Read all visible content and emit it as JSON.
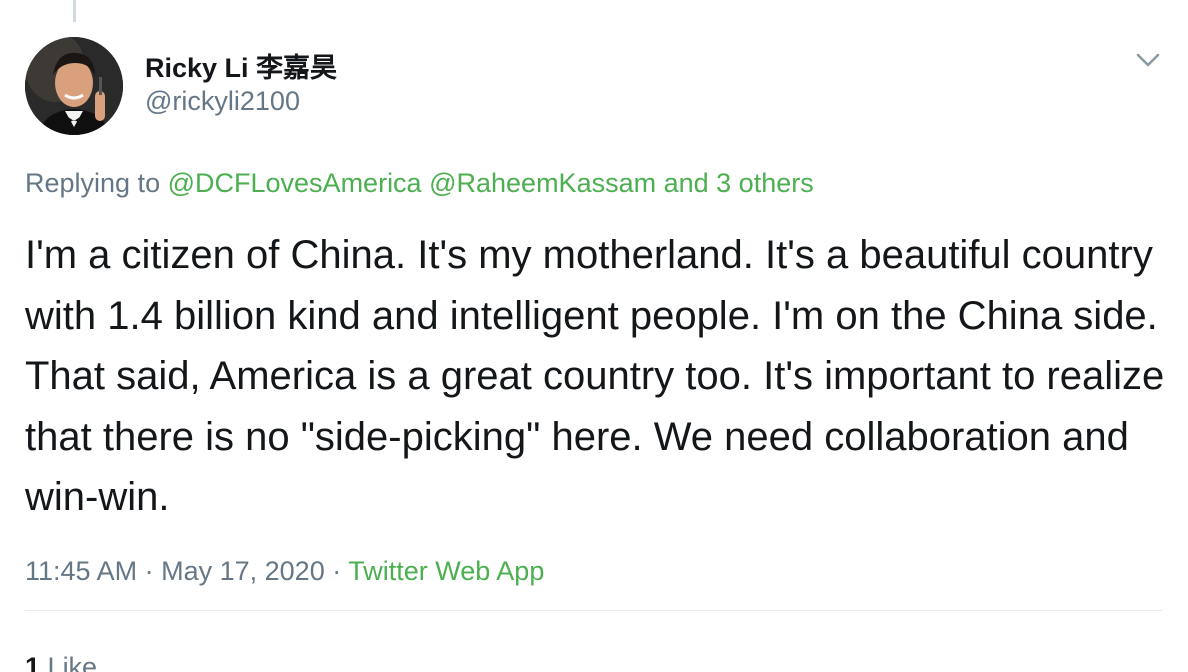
{
  "author": {
    "display_name": "Ricky Li",
    "display_name_cjk": "李嘉昊",
    "handle": "@rickyli2100"
  },
  "reply": {
    "prefix": "Replying to",
    "mentions": [
      "@DCFLovesAmerica",
      "@RaheemKassam"
    ],
    "others": "and 3 others"
  },
  "tweet": {
    "text": "I'm a citizen of China. It's my motherland. It's a beautiful country with 1.4 billion kind and intelligent people. I'm on the China side. That said, America is a great country too. It's important to realize that there is no \"side-picking\" here. We need collaboration and win-win."
  },
  "meta": {
    "time": "11:45 AM",
    "separator": "·",
    "date": "May 17, 2020",
    "source": "Twitter Web App"
  },
  "stats": {
    "likes_count": "1",
    "likes_label": "Like"
  },
  "colors": {
    "link": "#4caf50",
    "muted": "#657786",
    "text": "#14171a",
    "divider": "#e6ecf0"
  },
  "icons": {
    "menu": "chevron-down-icon"
  }
}
